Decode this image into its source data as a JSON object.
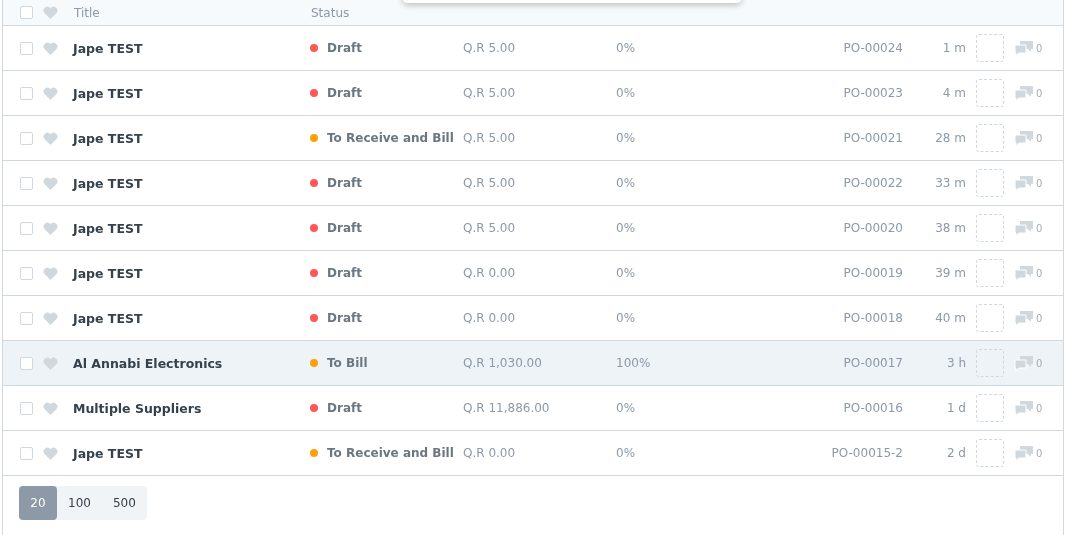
{
  "header": {
    "checked": false,
    "columns": [
      "Title",
      "Status"
    ]
  },
  "rows": [
    {
      "checked": false,
      "liked": false,
      "highlighted": false,
      "title": "Jape TEST",
      "status": "Draft",
      "color": "#ff5858",
      "amount": "Q.R 5.00",
      "percent": "0%",
      "name": "PO-00024",
      "modified": "1 m",
      "comments": "0"
    },
    {
      "checked": false,
      "liked": false,
      "highlighted": false,
      "title": "Jape TEST",
      "status": "Draft",
      "color": "#ff5858",
      "amount": "Q.R 5.00",
      "percent": "0%",
      "name": "PO-00023",
      "modified": "4 m",
      "comments": "0"
    },
    {
      "checked": false,
      "liked": false,
      "highlighted": false,
      "title": "Jape TEST",
      "status": "To Receive and Bill",
      "color": "#ffa00a",
      "amount": "Q.R 5.00",
      "percent": "0%",
      "name": "PO-00021",
      "modified": "28 m",
      "comments": "0"
    },
    {
      "checked": false,
      "liked": false,
      "highlighted": false,
      "title": "Jape TEST",
      "status": "Draft",
      "color": "#ff5858",
      "amount": "Q.R 5.00",
      "percent": "0%",
      "name": "PO-00022",
      "modified": "33 m",
      "comments": "0"
    },
    {
      "checked": false,
      "liked": false,
      "highlighted": false,
      "title": "Jape TEST",
      "status": "Draft",
      "color": "#ff5858",
      "amount": "Q.R 5.00",
      "percent": "0%",
      "name": "PO-00020",
      "modified": "38 m",
      "comments": "0"
    },
    {
      "checked": false,
      "liked": false,
      "highlighted": false,
      "title": "Jape TEST",
      "status": "Draft",
      "color": "#ff5858",
      "amount": "Q.R 0.00",
      "percent": "0%",
      "name": "PO-00019",
      "modified": "39 m",
      "comments": "0"
    },
    {
      "checked": false,
      "liked": false,
      "highlighted": false,
      "title": "Jape TEST",
      "status": "Draft",
      "color": "#ff5858",
      "amount": "Q.R 0.00",
      "percent": "0%",
      "name": "PO-00018",
      "modified": "40 m",
      "comments": "0"
    },
    {
      "checked": false,
      "liked": false,
      "highlighted": true,
      "title": "Al Annabi Electronics",
      "status": "To Bill",
      "color": "#ffa00a",
      "amount": "Q.R 1,030.00",
      "percent": "100%",
      "name": "PO-00017",
      "modified": "3 h",
      "comments": "0"
    },
    {
      "checked": false,
      "liked": false,
      "highlighted": false,
      "title": "Multiple Suppliers",
      "status": "Draft",
      "color": "#ff5858",
      "amount": "Q.R 11,886.00",
      "percent": "0%",
      "name": "PO-00016",
      "modified": "1 d",
      "comments": "0"
    },
    {
      "checked": false,
      "liked": false,
      "highlighted": false,
      "title": "Jape TEST",
      "status": "To Receive and Bill",
      "color": "#ffa00a",
      "amount": "Q.R 0.00",
      "percent": "0%",
      "name": "PO-00015-2",
      "modified": "2 d",
      "comments": "0"
    }
  ],
  "page_sizes": [
    {
      "label": "20",
      "selected": true
    },
    {
      "label": "100",
      "selected": false
    },
    {
      "label": "500",
      "selected": false
    }
  ]
}
